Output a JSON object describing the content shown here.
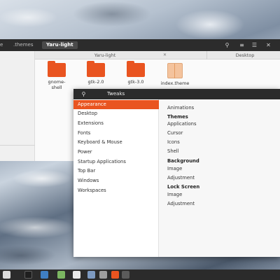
{
  "files": {
    "breadcrumbs": [
      ".themes",
      "Yaru-light"
    ],
    "breadcrumb_lead": "e",
    "tabs": [
      "Yaru-light",
      "Desktop"
    ],
    "items": [
      {
        "label": "gnome-\nshell",
        "type": "folder"
      },
      {
        "label": "gtk-2.0",
        "type": "folder"
      },
      {
        "label": "gtk-3.0",
        "type": "folder"
      },
      {
        "label": "index.theme",
        "type": "file"
      }
    ],
    "icons": [
      "search-icon",
      "list-view-icon",
      "menu-icon",
      "close-icon"
    ]
  },
  "tweaks": {
    "title": "Tweaks",
    "sidebar": [
      "Appearance",
      "Desktop",
      "Extensions",
      "Fonts",
      "Keyboard & Mouse",
      "Power",
      "Startup Applications",
      "Top Bar",
      "Windows",
      "Workspaces"
    ],
    "selected": "Appearance",
    "main": {
      "animations": "Animations",
      "themes_head": "Themes",
      "applications": "Applications",
      "cursor": "Cursor",
      "icons": "Icons",
      "shell": "Shell",
      "background_head": "Background",
      "bg_image": "Image",
      "bg_adjustment": "Adjustment",
      "lock_head": "Lock Screen",
      "lock_image": "Image",
      "lock_adjustment": "Adjustment"
    }
  },
  "colors": {
    "accent": "#e95420",
    "header": "#2b2b2b"
  },
  "taskbar": {
    "icons": [
      "window-icon",
      "terminal-icon",
      "files-icon",
      "chat-icon",
      "software-icon",
      "box-icon",
      "settings-icon",
      "app-icon",
      "media-icon"
    ]
  }
}
